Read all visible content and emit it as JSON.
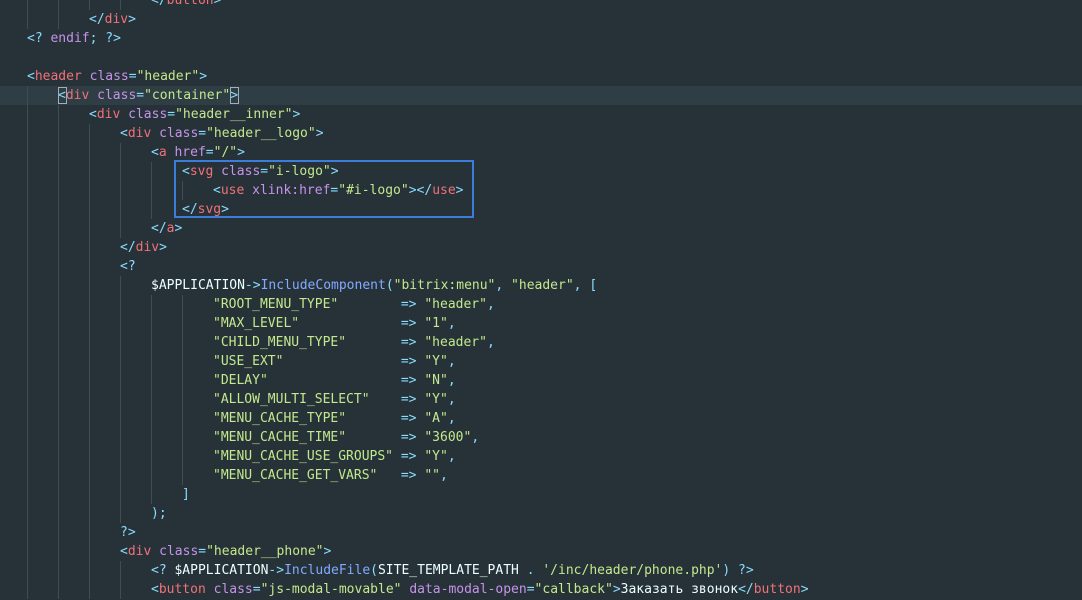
{
  "editor": {
    "lines": [
      {
        "indent": 5,
        "tokens": [
          [
            "tok-op",
            "</"
          ],
          [
            "tok-tag",
            "button"
          ],
          [
            "tok-op",
            ">"
          ]
        ]
      },
      {
        "indent": 3,
        "tokens": [
          [
            "tok-op",
            "</"
          ],
          [
            "tok-tag",
            "div"
          ],
          [
            "tok-op",
            ">"
          ]
        ]
      },
      {
        "indent": 1,
        "tokens": [
          [
            "tok-php",
            "<? "
          ],
          [
            "tok-kw",
            "endif"
          ],
          [
            "tok-punct",
            "; "
          ],
          [
            "tok-php",
            "?>"
          ]
        ]
      },
      {
        "indent": 0,
        "tokens": []
      },
      {
        "indent": 1,
        "tokens": [
          [
            "tok-op",
            "<"
          ],
          [
            "tok-tag",
            "header"
          ],
          [
            "tok-text",
            " "
          ],
          [
            "tok-attr",
            "class"
          ],
          [
            "tok-op",
            "="
          ],
          [
            "tok-str",
            "\"header\""
          ],
          [
            "tok-op",
            ">"
          ]
        ]
      },
      {
        "indent": 2,
        "current": true,
        "tokens": [
          [
            "tok-op",
            "<"
          ],
          [
            "tok-tag",
            "div"
          ],
          [
            "tok-text",
            " "
          ],
          [
            "tok-attr",
            "class"
          ],
          [
            "tok-op",
            "="
          ],
          [
            "tok-str",
            "\"container\""
          ],
          [
            "tok-op",
            ">"
          ]
        ]
      },
      {
        "indent": 3,
        "tokens": [
          [
            "tok-op",
            "<"
          ],
          [
            "tok-tag",
            "div"
          ],
          [
            "tok-text",
            " "
          ],
          [
            "tok-attr",
            "class"
          ],
          [
            "tok-op",
            "="
          ],
          [
            "tok-str",
            "\"header__inner\""
          ],
          [
            "tok-op",
            ">"
          ]
        ]
      },
      {
        "indent": 4,
        "tokens": [
          [
            "tok-op",
            "<"
          ],
          [
            "tok-tag",
            "div"
          ],
          [
            "tok-text",
            " "
          ],
          [
            "tok-attr",
            "class"
          ],
          [
            "tok-op",
            "="
          ],
          [
            "tok-str",
            "\"header__logo\""
          ],
          [
            "tok-op",
            ">"
          ]
        ]
      },
      {
        "indent": 5,
        "tokens": [
          [
            "tok-op",
            "<"
          ],
          [
            "tok-tag",
            "a"
          ],
          [
            "tok-text",
            " "
          ],
          [
            "tok-attr",
            "href"
          ],
          [
            "tok-op",
            "="
          ],
          [
            "tok-str",
            "\"/\""
          ],
          [
            "tok-op",
            ">"
          ]
        ]
      },
      {
        "indent": 6,
        "tokens": [
          [
            "tok-op",
            "<"
          ],
          [
            "tok-tag",
            "svg"
          ],
          [
            "tok-text",
            " "
          ],
          [
            "tok-attr",
            "class"
          ],
          [
            "tok-op",
            "="
          ],
          [
            "tok-str",
            "\"i-logo\""
          ],
          [
            "tok-op",
            ">"
          ]
        ]
      },
      {
        "indent": 7,
        "tokens": [
          [
            "tok-op",
            "<"
          ],
          [
            "tok-tag",
            "use"
          ],
          [
            "tok-text",
            " "
          ],
          [
            "tok-attr",
            "xlink:href"
          ],
          [
            "tok-op",
            "="
          ],
          [
            "tok-str",
            "\"#i-logo\""
          ],
          [
            "tok-op",
            "></"
          ],
          [
            "tok-tag",
            "use"
          ],
          [
            "tok-op",
            ">"
          ]
        ]
      },
      {
        "indent": 6,
        "tokens": [
          [
            "tok-op",
            "</"
          ],
          [
            "tok-tag",
            "svg"
          ],
          [
            "tok-op",
            ">"
          ]
        ]
      },
      {
        "indent": 5,
        "tokens": [
          [
            "tok-op",
            "</"
          ],
          [
            "tok-tag",
            "a"
          ],
          [
            "tok-op",
            ">"
          ]
        ]
      },
      {
        "indent": 4,
        "tokens": [
          [
            "tok-op",
            "</"
          ],
          [
            "tok-tag",
            "div"
          ],
          [
            "tok-op",
            ">"
          ]
        ]
      },
      {
        "indent": 4,
        "tokens": [
          [
            "tok-php",
            "<?"
          ]
        ]
      },
      {
        "indent": 5,
        "tokens": [
          [
            "tok-var",
            "$APPLICATION"
          ],
          [
            "tok-op",
            "->"
          ],
          [
            "tok-fn",
            "IncludeComponent"
          ],
          [
            "tok-punct",
            "("
          ],
          [
            "tok-str",
            "\"bitrix:menu\""
          ],
          [
            "tok-punct",
            ", "
          ],
          [
            "tok-str",
            "\"header\""
          ],
          [
            "tok-punct",
            ", ["
          ]
        ]
      },
      {
        "indent": 7,
        "tokens": [
          [
            "tok-str",
            "\"ROOT_MENU_TYPE\""
          ],
          [
            "tok-text",
            "        "
          ],
          [
            "tok-op",
            "=>"
          ],
          [
            "tok-text",
            " "
          ],
          [
            "tok-str",
            "\"header\""
          ],
          [
            "tok-punct",
            ","
          ]
        ]
      },
      {
        "indent": 7,
        "tokens": [
          [
            "tok-str",
            "\"MAX_LEVEL\""
          ],
          [
            "tok-text",
            "             "
          ],
          [
            "tok-op",
            "=>"
          ],
          [
            "tok-text",
            " "
          ],
          [
            "tok-str",
            "\"1\""
          ],
          [
            "tok-punct",
            ","
          ]
        ]
      },
      {
        "indent": 7,
        "tokens": [
          [
            "tok-str",
            "\"CHILD_MENU_TYPE\""
          ],
          [
            "tok-text",
            "       "
          ],
          [
            "tok-op",
            "=>"
          ],
          [
            "tok-text",
            " "
          ],
          [
            "tok-str",
            "\"header\""
          ],
          [
            "tok-punct",
            ","
          ]
        ]
      },
      {
        "indent": 7,
        "tokens": [
          [
            "tok-str",
            "\"USE_EXT\""
          ],
          [
            "tok-text",
            "               "
          ],
          [
            "tok-op",
            "=>"
          ],
          [
            "tok-text",
            " "
          ],
          [
            "tok-str",
            "\"Y\""
          ],
          [
            "tok-punct",
            ","
          ]
        ]
      },
      {
        "indent": 7,
        "tokens": [
          [
            "tok-str",
            "\"DELAY\""
          ],
          [
            "tok-text",
            "                 "
          ],
          [
            "tok-op",
            "=>"
          ],
          [
            "tok-text",
            " "
          ],
          [
            "tok-str",
            "\"N\""
          ],
          [
            "tok-punct",
            ","
          ]
        ]
      },
      {
        "indent": 7,
        "tokens": [
          [
            "tok-str",
            "\"ALLOW_MULTI_SELECT\""
          ],
          [
            "tok-text",
            "    "
          ],
          [
            "tok-op",
            "=>"
          ],
          [
            "tok-text",
            " "
          ],
          [
            "tok-str",
            "\"Y\""
          ],
          [
            "tok-punct",
            ","
          ]
        ]
      },
      {
        "indent": 7,
        "tokens": [
          [
            "tok-str",
            "\"MENU_CACHE_TYPE\""
          ],
          [
            "tok-text",
            "       "
          ],
          [
            "tok-op",
            "=>"
          ],
          [
            "tok-text",
            " "
          ],
          [
            "tok-str",
            "\"A\""
          ],
          [
            "tok-punct",
            ","
          ]
        ]
      },
      {
        "indent": 7,
        "tokens": [
          [
            "tok-str",
            "\"MENU_CACHE_TIME\""
          ],
          [
            "tok-text",
            "       "
          ],
          [
            "tok-op",
            "=>"
          ],
          [
            "tok-text",
            " "
          ],
          [
            "tok-str",
            "\"3600\""
          ],
          [
            "tok-punct",
            ","
          ]
        ]
      },
      {
        "indent": 7,
        "tokens": [
          [
            "tok-str",
            "\"MENU_CACHE_USE_GROUPS\""
          ],
          [
            "tok-text",
            " "
          ],
          [
            "tok-op",
            "=>"
          ],
          [
            "tok-text",
            " "
          ],
          [
            "tok-str",
            "\"Y\""
          ],
          [
            "tok-punct",
            ","
          ]
        ]
      },
      {
        "indent": 7,
        "tokens": [
          [
            "tok-str",
            "\"MENU_CACHE_GET_VARS\""
          ],
          [
            "tok-text",
            "   "
          ],
          [
            "tok-op",
            "=>"
          ],
          [
            "tok-text",
            " "
          ],
          [
            "tok-str",
            "\"\""
          ],
          [
            "tok-punct",
            ","
          ]
        ]
      },
      {
        "indent": 6,
        "tokens": [
          [
            "tok-punct",
            "]"
          ]
        ]
      },
      {
        "indent": 5,
        "tokens": [
          [
            "tok-punct",
            ");"
          ]
        ]
      },
      {
        "indent": 4,
        "tokens": [
          [
            "tok-php",
            "?>"
          ]
        ]
      },
      {
        "indent": 4,
        "tokens": [
          [
            "tok-op",
            "<"
          ],
          [
            "tok-tag",
            "div"
          ],
          [
            "tok-text",
            " "
          ],
          [
            "tok-attr",
            "class"
          ],
          [
            "tok-op",
            "="
          ],
          [
            "tok-str",
            "\"header__phone\""
          ],
          [
            "tok-op",
            ">"
          ]
        ]
      },
      {
        "indent": 5,
        "tokens": [
          [
            "tok-php",
            "<? "
          ],
          [
            "tok-var",
            "$APPLICATION"
          ],
          [
            "tok-op",
            "->"
          ],
          [
            "tok-fn",
            "IncludeFile"
          ],
          [
            "tok-punct",
            "("
          ],
          [
            "tok-const",
            "SITE_TEMPLATE_PATH"
          ],
          [
            "tok-text",
            " "
          ],
          [
            "tok-op",
            "."
          ],
          [
            "tok-text",
            " "
          ],
          [
            "tok-str",
            "'/inc/header/phone.php'"
          ],
          [
            "tok-punct",
            ")"
          ],
          [
            "tok-text",
            " "
          ],
          [
            "tok-php",
            "?>"
          ]
        ]
      },
      {
        "indent": 5,
        "tokens": [
          [
            "tok-op",
            "<"
          ],
          [
            "tok-tag",
            "button"
          ],
          [
            "tok-text",
            " "
          ],
          [
            "tok-attr",
            "class"
          ],
          [
            "tok-op",
            "="
          ],
          [
            "tok-str",
            "\"js-modal-movable\""
          ],
          [
            "tok-text",
            " "
          ],
          [
            "tok-attr",
            "data-modal-open"
          ],
          [
            "tok-op",
            "="
          ],
          [
            "tok-str",
            "\"callback\""
          ],
          [
            "tok-op",
            ">"
          ],
          [
            "tok-text",
            "Заказать звонок"
          ],
          [
            "tok-op",
            "</"
          ],
          [
            "tok-tag",
            "button"
          ],
          [
            "tok-op",
            ">"
          ]
        ]
      }
    ]
  }
}
